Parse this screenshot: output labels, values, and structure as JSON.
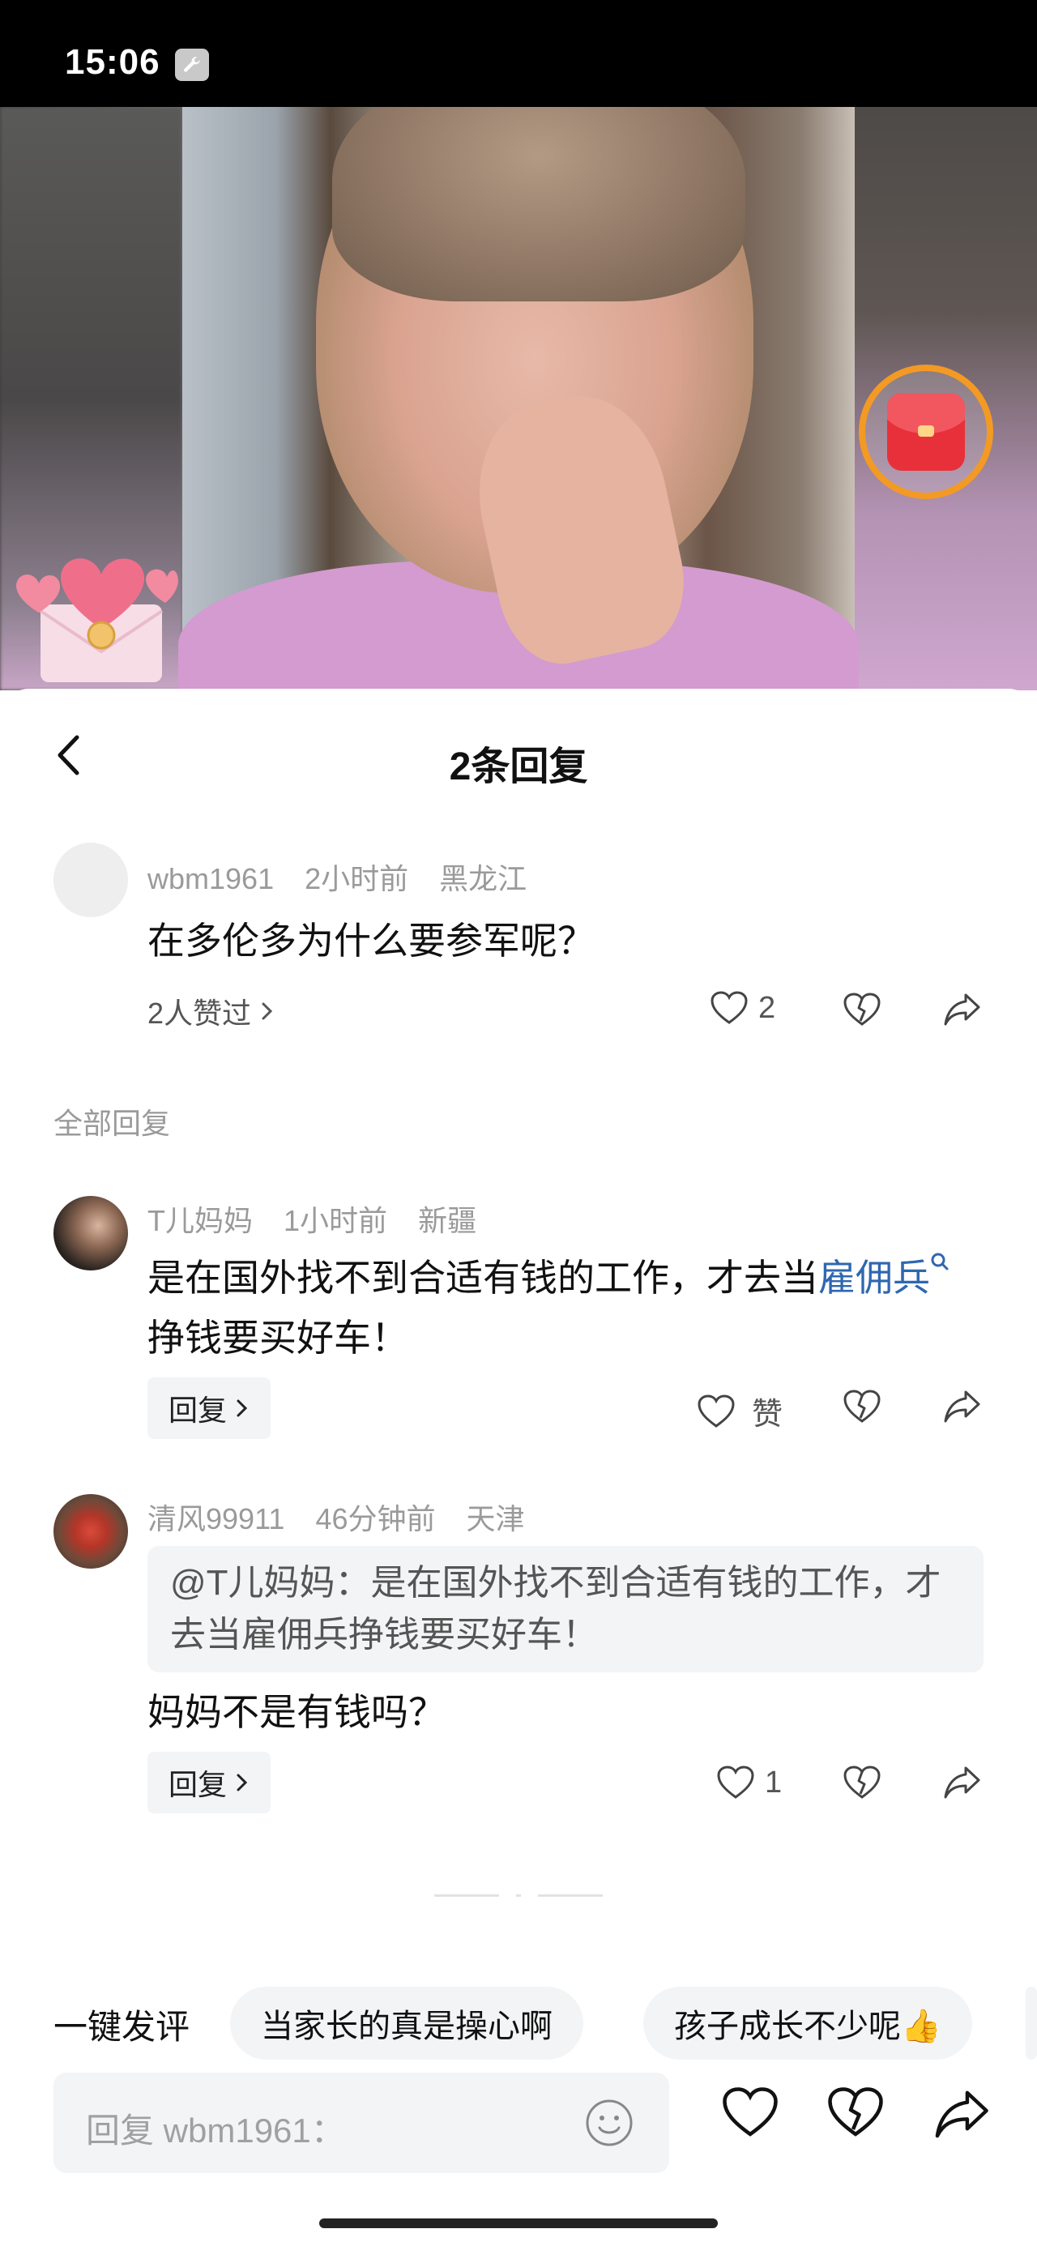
{
  "status_bar": {
    "time": "15:06"
  },
  "sheet": {
    "title": "2条回复"
  },
  "main_comment": {
    "user": "wbm1961",
    "time": "2小时前",
    "location": "黑龙江",
    "text": "在多伦多为什么要参军呢？",
    "likes_summary": "2人赞过",
    "like_count": "2"
  },
  "section_label": "全部回复",
  "replies": [
    {
      "user": "T儿妈妈",
      "time": "1小时前",
      "location": "新疆",
      "text_before_link": "是在国外找不到合适有钱的工作，才去当",
      "link_text": "雇佣兵",
      "text_after_link": " 挣钱要买好车！",
      "reply_label": "回复",
      "like_label": "赞"
    },
    {
      "user": "清风99911",
      "time": "46分钟前",
      "location": "天津",
      "quote": "@T儿妈妈：是在国外找不到合适有钱的工作，才去当雇佣兵挣钱要买好车！",
      "text": "妈妈不是有钱吗？",
      "reply_label": "回复",
      "like_count": "1"
    }
  ],
  "quick_comments": {
    "label": "一键发评",
    "chips": [
      "当家长的真是操心啊",
      "孩子成长不少呢👍"
    ]
  },
  "reply_input": {
    "placeholder": "回复 wbm1961："
  },
  "colors": {
    "link": "#2f67b0",
    "accent_orange": "#f39a24",
    "red_packet": "#e8303a"
  }
}
